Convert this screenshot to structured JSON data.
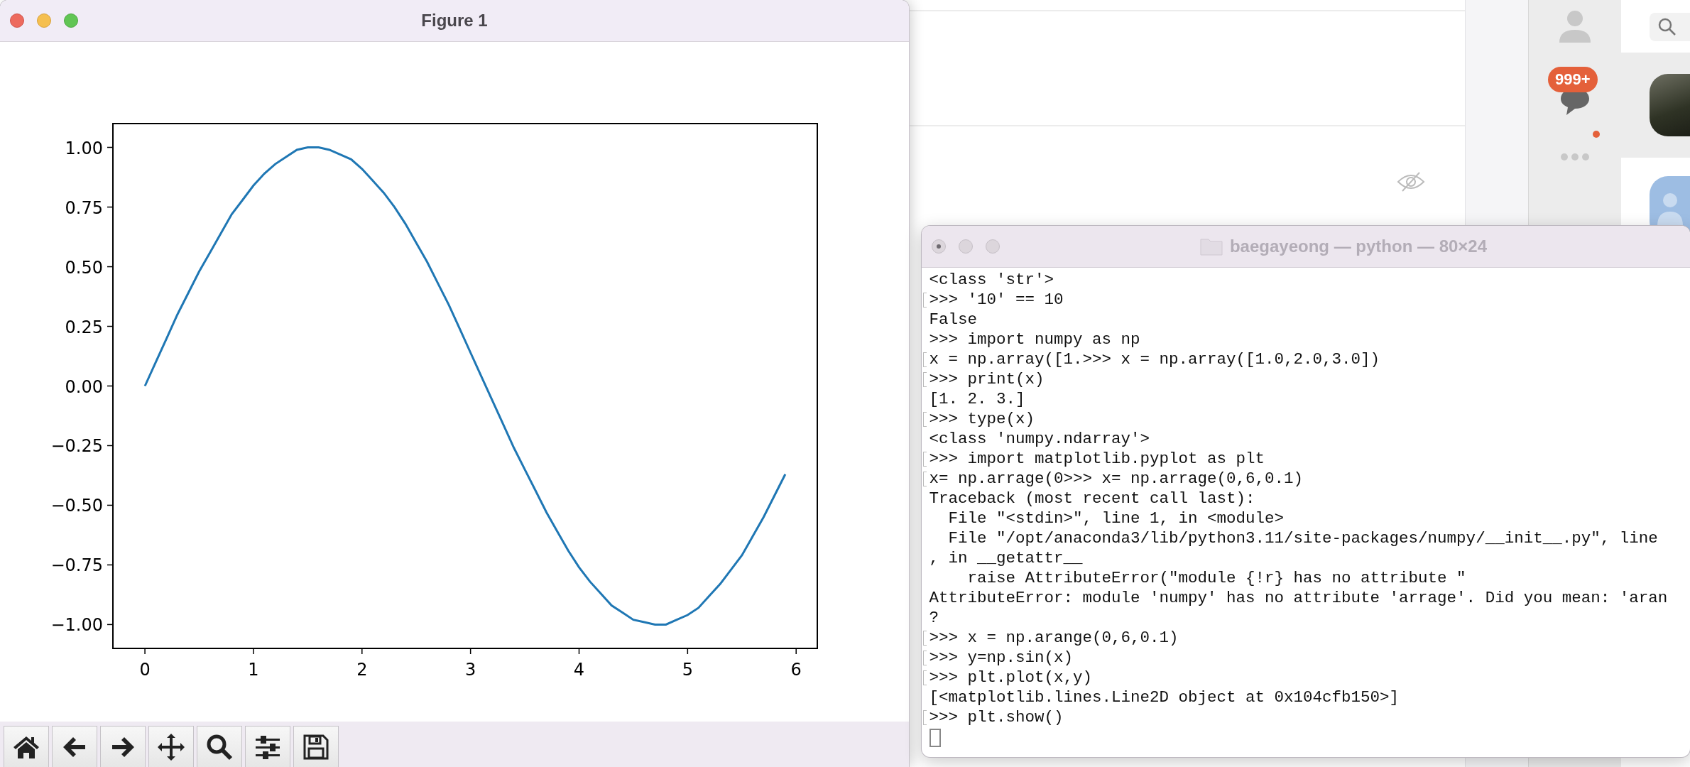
{
  "figure_window": {
    "title": "Figure 1",
    "focused": true,
    "chart_data": {
      "type": "line",
      "xlim": [
        -0.295,
        6.195
      ],
      "ylim": [
        -1.1,
        1.1
      ],
      "xticks": [
        0,
        1,
        2,
        3,
        4,
        5,
        6
      ],
      "yticks": [
        {
          "value": -1,
          "label": "−1.00"
        },
        {
          "value": -0.75,
          "label": "−0.75"
        },
        {
          "value": -0.5,
          "label": "−0.50"
        },
        {
          "value": -0.25,
          "label": "−0.25"
        },
        {
          "value": 0,
          "label": "0.00"
        },
        {
          "value": 0.25,
          "label": "0.25"
        },
        {
          "value": 0.5,
          "label": "0.50"
        },
        {
          "value": 0.75,
          "label": "0.75"
        },
        {
          "value": 1,
          "label": "1.00"
        }
      ],
      "x": [
        0,
        0.1,
        0.2,
        0.3,
        0.4,
        0.5,
        0.6,
        0.7,
        0.8,
        0.9,
        1,
        1.1,
        1.2,
        1.3,
        1.4,
        1.5,
        1.6,
        1.7,
        1.8,
        1.9,
        2,
        2.1,
        2.2,
        2.3,
        2.4,
        2.5,
        2.6,
        2.7,
        2.8,
        2.9,
        3,
        3.1,
        3.2,
        3.3,
        3.4,
        3.5,
        3.6,
        3.7,
        3.8,
        3.9,
        4,
        4.1,
        4.2,
        4.3,
        4.4,
        4.5,
        4.6,
        4.7,
        4.8,
        4.9,
        5,
        5.1,
        5.2,
        5.3,
        5.4,
        5.5,
        5.6,
        5.7,
        5.8,
        5.9
      ],
      "series": [
        {
          "color": "#1f77b4",
          "values": [
            0,
            0.1,
            0.2,
            0.3,
            0.39,
            0.48,
            0.56,
            0.64,
            0.72,
            0.78,
            0.84,
            0.89,
            0.93,
            0.96,
            0.99,
            1,
            1,
            0.99,
            0.97,
            0.95,
            0.91,
            0.86,
            0.81,
            0.75,
            0.68,
            0.6,
            0.52,
            0.43,
            0.34,
            0.24,
            0.14,
            0.04,
            -0.06,
            -0.16,
            -0.26,
            -0.35,
            -0.44,
            -0.53,
            -0.61,
            -0.69,
            -0.76,
            -0.82,
            -0.87,
            -0.92,
            -0.95,
            -0.98,
            -0.99,
            -1,
            -1,
            -0.98,
            -0.96,
            -0.93,
            -0.88,
            -0.83,
            -0.77,
            -0.71,
            -0.63,
            -0.55,
            -0.46,
            -0.37
          ]
        }
      ]
    }
  },
  "background_app": {
    "badge": "999+"
  },
  "terminal_window": {
    "title": "baegayeong — python — 80×24",
    "focused": false,
    "lines": [
      {
        "text": "<class 'str'>",
        "marked": false
      },
      {
        "text": ">>> '10' == 10",
        "marked": true
      },
      {
        "text": "False",
        "marked": false
      },
      {
        "text": ">>> import numpy as np",
        "marked": false
      },
      {
        "text": "x = np.array([1.>>> x = np.array([1.0,2.0,3.0])",
        "marked": true
      },
      {
        "text": ">>> print(x)",
        "marked": true
      },
      {
        "text": "[1. 2. 3.]",
        "marked": false
      },
      {
        "text": ">>> type(x)",
        "marked": true
      },
      {
        "text": "<class 'numpy.ndarray'>",
        "marked": false
      },
      {
        "text": ">>> import matplotlib.pyplot as plt",
        "marked": true
      },
      {
        "text": "x= np.arrage(0>>> x= np.arrage(0,6,0.1)",
        "marked": true
      },
      {
        "text": "Traceback (most recent call last):",
        "marked": false
      },
      {
        "text": "  File \"<stdin>\", line 1, in <module>",
        "marked": false
      },
      {
        "text": "  File \"/opt/anaconda3/lib/python3.11/site-packages/numpy/__init__.py\", line",
        "marked": false
      },
      {
        "text": ", in __getattr__",
        "marked": false
      },
      {
        "text": "    raise AttributeError(\"module {!r} has no attribute \"",
        "marked": false
      },
      {
        "text": "AttributeError: module 'numpy' has no attribute 'arrage'. Did you mean: 'aran",
        "marked": false
      },
      {
        "text": "?",
        "marked": false
      },
      {
        "text": ">>> x = np.arange(0,6,0.1)",
        "marked": true
      },
      {
        "text": ">>> y=np.sin(x)",
        "marked": true
      },
      {
        "text": ">>> plt.plot(x,y)",
        "marked": true
      },
      {
        "text": "[<matplotlib.lines.Line2D object at 0x104cfb150>]",
        "marked": false
      },
      {
        "text": ">>> plt.show()",
        "marked": true
      }
    ]
  }
}
